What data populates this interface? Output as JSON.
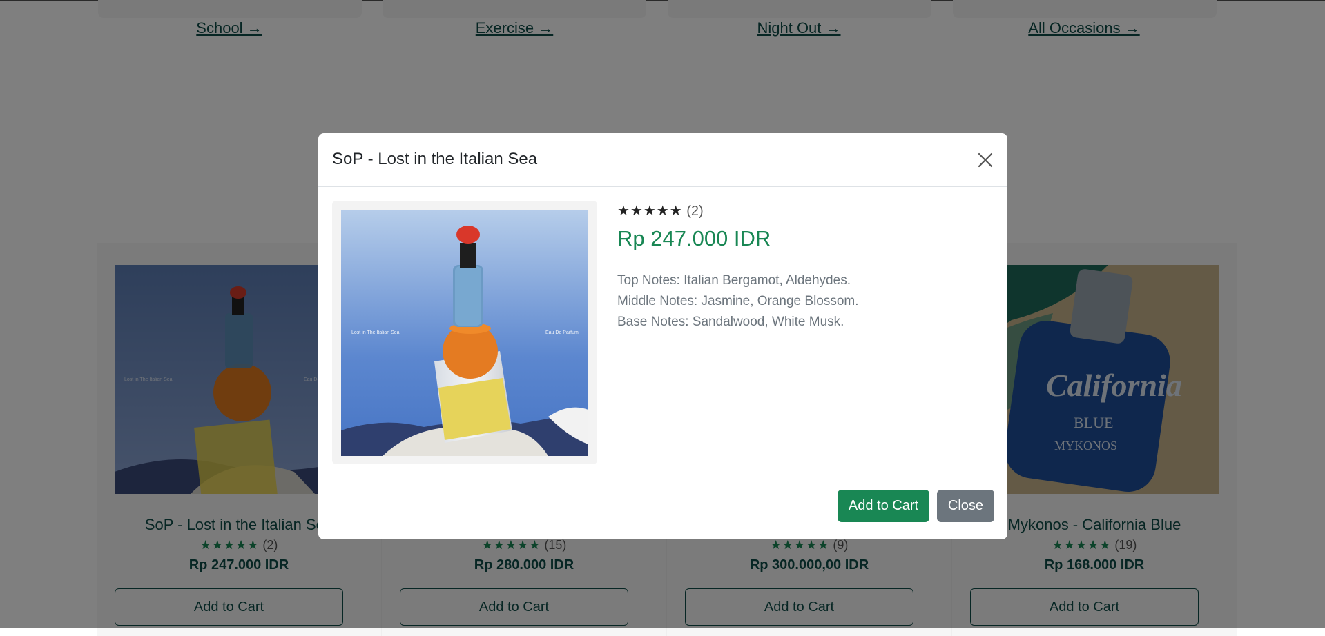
{
  "occasions": [
    {
      "label": "School →"
    },
    {
      "label": "Exercise →"
    },
    {
      "label": "Night Out →"
    },
    {
      "label": "All Occasions →"
    }
  ],
  "products": [
    {
      "name": "SoP - Lost in the Italian Sea",
      "stars": "★★★★★",
      "count": "(2)",
      "price": "Rp 247.000 IDR",
      "button": "Add to Cart",
      "img_left_text": "Lost in The Italian Sea",
      "img_right_text": "Eau De Parfum"
    },
    {
      "name": "",
      "stars": "★★★★★",
      "count": "(15)",
      "price": "Rp 280.000 IDR",
      "button": "Add to Cart"
    },
    {
      "name": "",
      "stars": "★★★★★",
      "count": "(9)",
      "price": "Rp 300.000,00 IDR",
      "button": "Add to Cart"
    },
    {
      "name": "Mykonos - California Blue",
      "stars": "★★★★★",
      "count": "(19)",
      "price": "Rp 168.000 IDR",
      "button": "Add to Cart",
      "img_text_1": "California",
      "img_text_2": "BLUE",
      "img_text_3": "MYKONOS"
    }
  ],
  "modal": {
    "title": "SoP - Lost in the Italian Sea",
    "stars": "★★★★★",
    "count": "(2)",
    "price": "Rp 247.000 IDR",
    "img_left_text": "Lost in The Italian Sea.",
    "img_right_text": "Eau De Parfum",
    "notes": {
      "top": "Top Notes: Italian Bergamot, Aldehydes.",
      "middle": "Middle Notes: Jasmine, Orange Blossom.",
      "base": "Base Notes: Sandalwood, White Musk."
    },
    "add_button": "Add to Cart",
    "close_button": "Close",
    "close_icon": "close-x-icon"
  },
  "colors": {
    "brand_green": "#198754",
    "dark_teal": "#0f4d48",
    "secondary_gray": "#6c757d"
  }
}
